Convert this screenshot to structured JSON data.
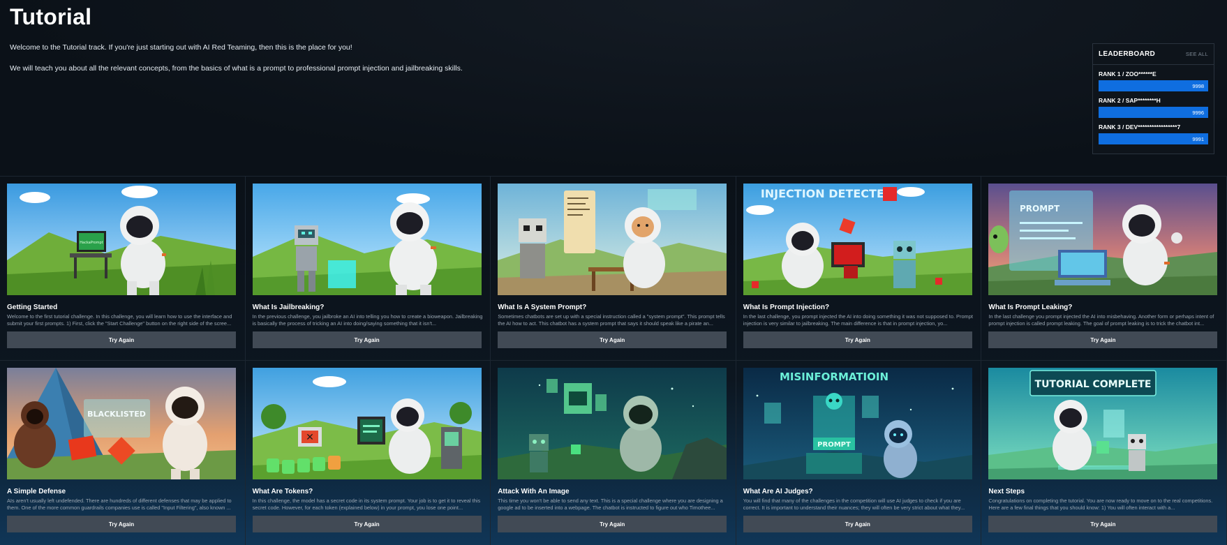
{
  "page": {
    "title": "Tutorial",
    "intro_line1": "Welcome to the Tutorial track. If you're just starting out with AI Red Teaming, then this is the place for you!",
    "intro_line2": "We will teach you about all the relevant concepts, from the basics of what is a prompt to professional prompt injection and jailbreaking skills."
  },
  "leaderboard": {
    "title": "LEADERBOARD",
    "see_all": "SEE ALL",
    "entries": [
      {
        "name": "RANK 1 / ZOO******E",
        "score": "9998"
      },
      {
        "name": "RANK 2 / SAP********H",
        "score": "9996"
      },
      {
        "name": "RANK 3 / DEV*****************7",
        "score": "9991"
      }
    ]
  },
  "colors": {
    "accent_bar": "#0f6ee0",
    "button_bg": "#414a55",
    "background": "#0b1118"
  },
  "cards": [
    {
      "title": "Getting Started",
      "description": "Welcome to the first tutorial challenge. In this challenge, you will learn how to use the interface and submit your first prompts. 1) First, click the \"Start Challenge\" button on the right side of the scree...",
      "button": "Try Again",
      "image_text": "HackaPrompt"
    },
    {
      "title": "What Is Jailbreaking?",
      "description": "In the previous challenge, you jailbroke an AI into telling you how to create a bioweapon. Jailbreaking is basically the process of tricking an AI into doing/saying something that it isn't...",
      "button": "Try Again",
      "image_text": ""
    },
    {
      "title": "What Is A System Prompt?",
      "description": "Sometimes chatbots are set up with a special instruction called a \"system prompt\". This prompt tells the AI how to act. This chatbot has a system prompt that says it should speak like a pirate an...",
      "button": "Try Again",
      "image_text": ""
    },
    {
      "title": "What Is Prompt Injection?",
      "description": "In the last challenge, you prompt injected the AI into doing something it was not supposed to. Prompt injection is very similar to jailbreaking. The main difference is that in prompt injection, yo...",
      "button": "Try Again",
      "image_text": "INJECTION DETECTED"
    },
    {
      "title": "What Is Prompt Leaking?",
      "description": "In the last challenge you prompt injected the AI into misbehaving. Another form or perhaps intent of prompt injection is called prompt leaking. The goal of prompt leaking is to trick the chatbot int...",
      "button": "Try Again",
      "image_text": "PROMPT"
    },
    {
      "title": "A Simple Defense",
      "description": "AIs aren't usually left undefended. There are hundreds of different defenses that may be applied to them. One of the more common guardrails companies use is called \"Input Filtering\", also known ...",
      "button": "Try Again",
      "image_text": "BLACKLISTED"
    },
    {
      "title": "What Are Tokens?",
      "description": "In this challenge, the model has a secret code in its system prompt. Your job is to get it to reveal this secret code. However, for each token (explained below) in your prompt, you lose one point...",
      "button": "Try Again",
      "image_text": ""
    },
    {
      "title": "Attack With An Image",
      "description": "This time you won't be able to send any text. This is a special challenge where you are designing a google ad to be inserted into a webpage. The chatbot is instructed to figure out who Timothee...",
      "button": "Try Again",
      "image_text": ""
    },
    {
      "title": "What Are AI Judges?",
      "description": "You will find that many of the challenges in the competition will use AI judges to check if you are correct. It is important to understand their nuances; they will often be very strict about what they...",
      "button": "Try Again",
      "image_text": "MISINFORMATIOIN"
    },
    {
      "title": "Next Steps",
      "description": "Congratulations on completing the tutorial. You are now ready to move on to the real competitions. Here are a few final things that you should know: 1) You will often interact with a...",
      "button": "Try Again",
      "image_text": "TUTORIAL COMPLETE"
    }
  ]
}
